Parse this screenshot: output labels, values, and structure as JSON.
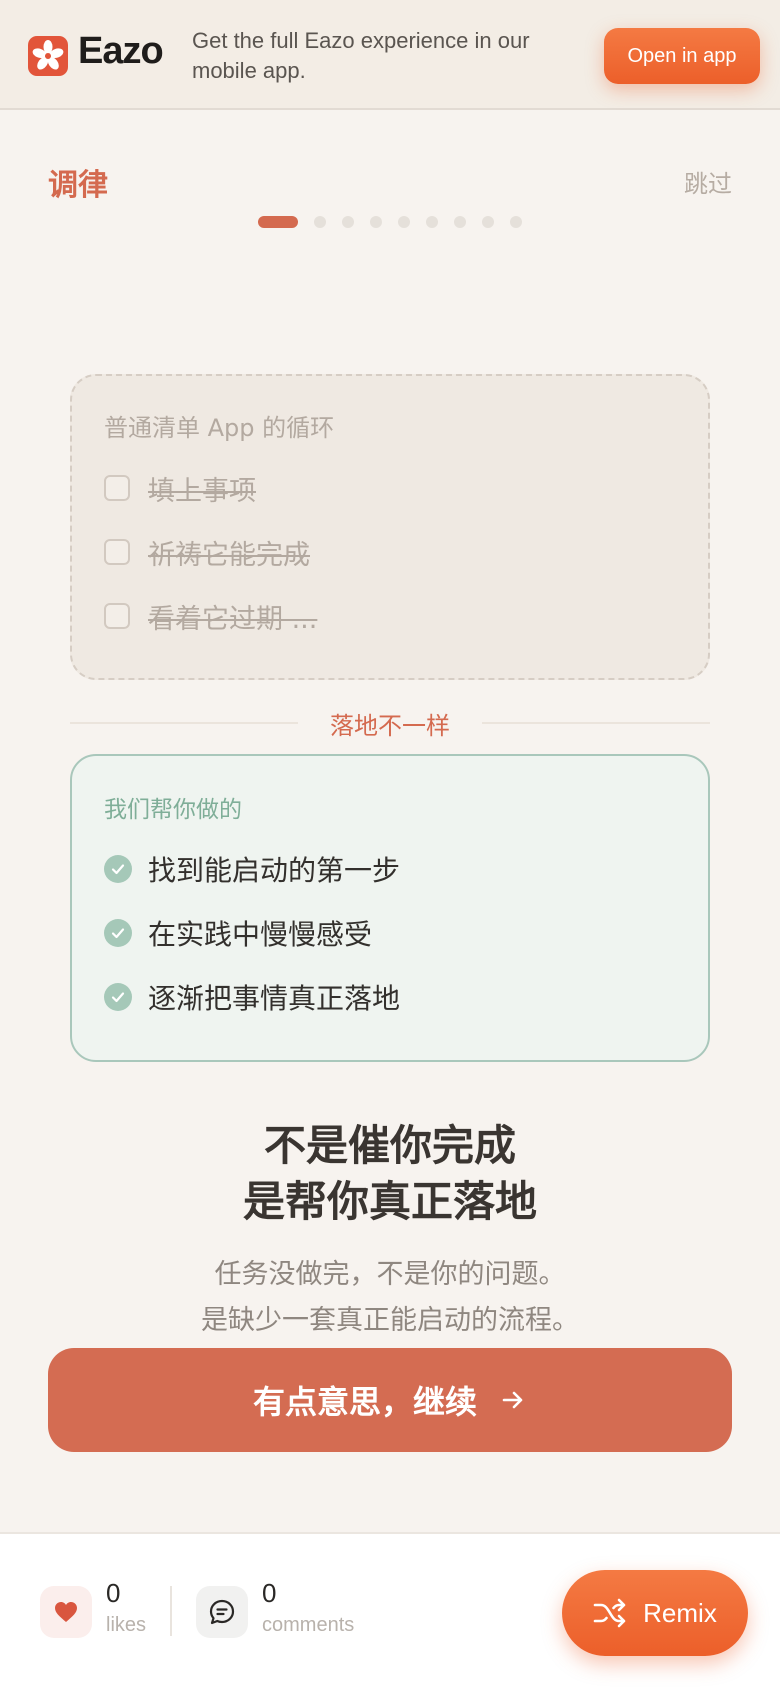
{
  "banner": {
    "brand": "Eazo",
    "message": "Get the full Eazo experience in our mobile app.",
    "open_label": "Open in app",
    "accent": "#ec5f2a"
  },
  "header": {
    "title": "调律",
    "skip_label": "跳过",
    "steps_total": 10,
    "steps_current": 1
  },
  "old_cycle": {
    "title": "普通清单 App 的循环",
    "items": [
      "填上事项",
      "祈祷它能完成",
      "看着它过期 ..."
    ]
  },
  "divider": {
    "label": "落地不一样"
  },
  "new_way": {
    "title": "我们帮你做的",
    "items": [
      "找到能启动的第一步",
      "在实践中慢慢感受",
      "逐渐把事情真正落地"
    ]
  },
  "headline": {
    "line1": "不是催你完成",
    "line2": "是帮你真正落地"
  },
  "subtext": {
    "line1": "任务没做完，不是你的问题。",
    "line2": "是缺少一套真正能启动的流程。"
  },
  "cta": {
    "label": "有点意思，继续",
    "color": "#d46c52"
  },
  "footer": {
    "likes_count": "0",
    "likes_label": "likes",
    "comments_count": "0",
    "comments_label": "comments",
    "remix_label": "Remix"
  }
}
